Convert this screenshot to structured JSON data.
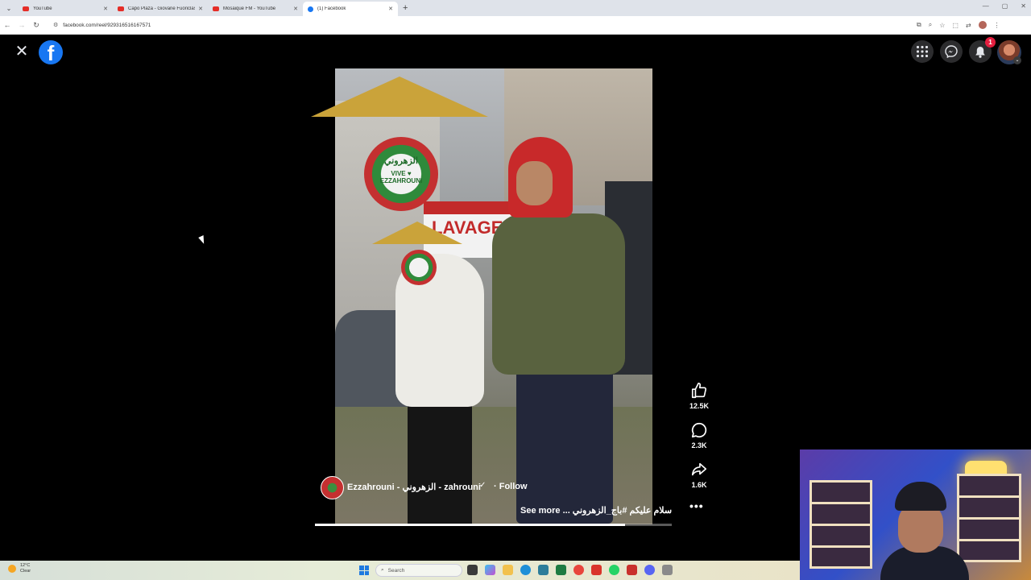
{
  "browser": {
    "tabs": [
      {
        "label": "YouTube",
        "favicon": "youtube-icon",
        "active": false
      },
      {
        "label": "Capo Plaza - Giovane Fuoriclas",
        "favicon": "youtube-icon",
        "active": false
      },
      {
        "label": "Mosaique FM - YouTube",
        "favicon": "youtube-icon",
        "active": false
      },
      {
        "label": "(1) Facebook",
        "favicon": "facebook-icon",
        "active": true
      }
    ],
    "url": "facebook.com/reel/929316516167571"
  },
  "facebook": {
    "logo_letter": "f",
    "notification_count": "1"
  },
  "reel": {
    "author": "Ezzahrouni - الزهروني - zahrouni",
    "verified_icon": "✓",
    "follow_label": "· Follow",
    "caption": "سلام عليكم #باج_الزهروني ... See more",
    "emblem_text_1": "الزهروني",
    "emblem_text_2": "VIVE ♥ EZZAHROUNI",
    "sign_text": "LAVAGE",
    "progress_fraction": 0.87,
    "likes": "12.5K",
    "comments": "2.3K",
    "shares": "1.6K",
    "more_label": "•••"
  },
  "taskbar": {
    "weather_temp": "12°C",
    "weather_desc": "Clear",
    "search_placeholder": "Search"
  },
  "colors": {
    "facebook_blue": "#1877f2",
    "notification_red": "#e41e3f",
    "youtube_red": "#e52d27"
  }
}
